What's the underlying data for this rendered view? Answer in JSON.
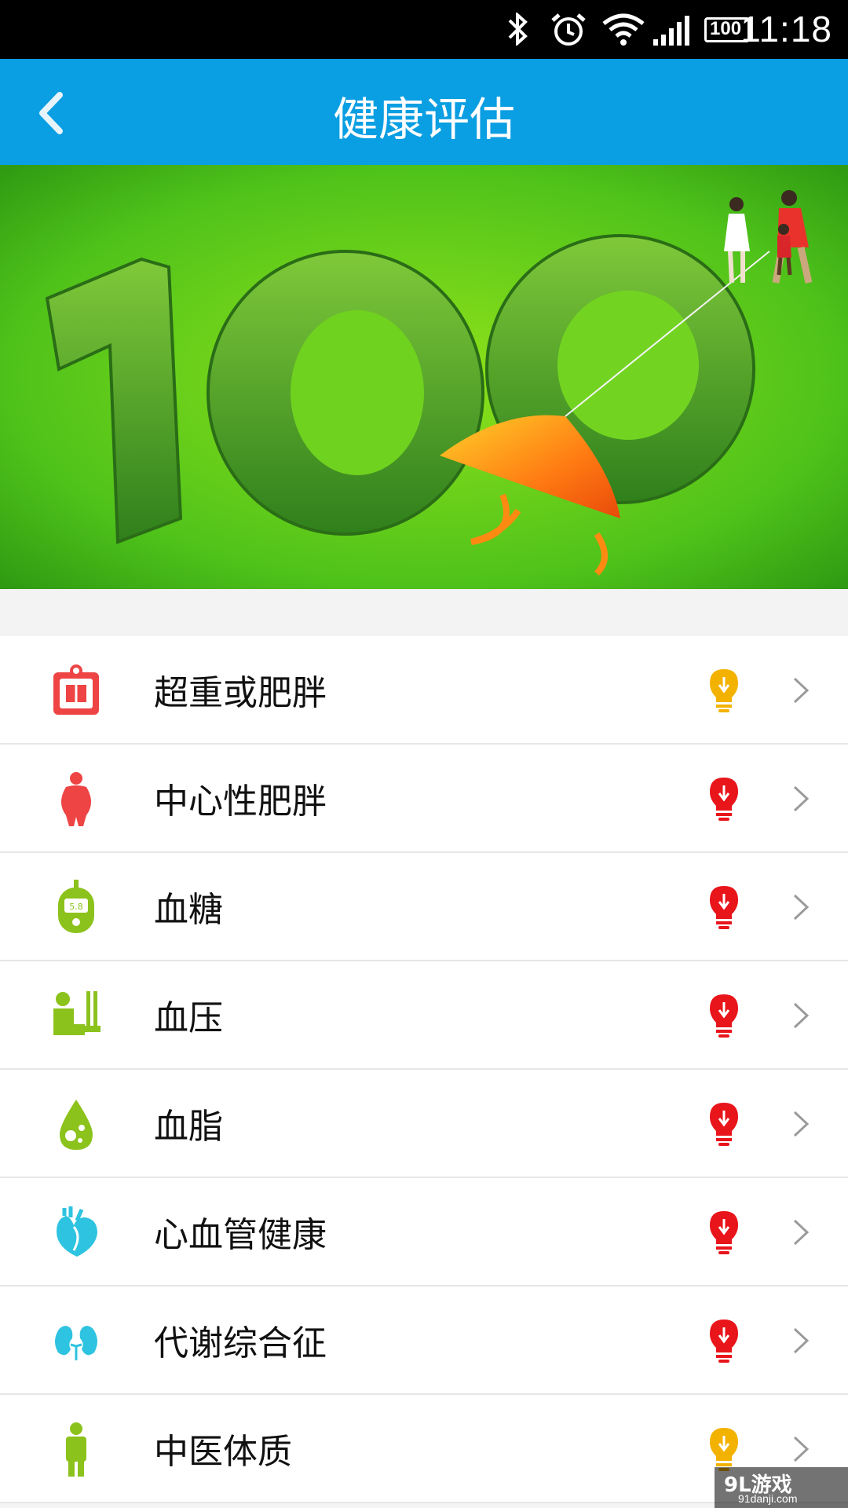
{
  "status_bar": {
    "time": "11:18",
    "battery": "100",
    "icons": [
      "bluetooth-icon",
      "alarm-icon",
      "wifi-icon",
      "signal-icon",
      "battery-icon"
    ]
  },
  "app_bar": {
    "title": "健康评估",
    "back_icon": "back-arrow-icon",
    "color": "#0a9ee2"
  },
  "banner": {
    "text": "100",
    "description_icon": "banner-image"
  },
  "assessments": [
    {
      "label": "超重或肥胖",
      "icon": "scale-icon",
      "icon_color": "#ee4444",
      "status": "yellow"
    },
    {
      "label": "中心性肥胖",
      "icon": "body-icon",
      "icon_color": "#ee4444",
      "status": "red"
    },
    {
      "label": "血糖",
      "icon": "glucose-meter-icon",
      "icon_color": "#8cc21c",
      "status": "red"
    },
    {
      "label": "血压",
      "icon": "blood-pressure-icon",
      "icon_color": "#8cc21c",
      "status": "red"
    },
    {
      "label": "血脂",
      "icon": "lipid-drop-icon",
      "icon_color": "#8cc21c",
      "status": "red"
    },
    {
      "label": "心血管健康",
      "icon": "heart-icon",
      "icon_color": "#2ec3e0",
      "status": "red"
    },
    {
      "label": "代谢综合征",
      "icon": "kidney-icon",
      "icon_color": "#2ec3e0",
      "status": "red"
    },
    {
      "label": "中医体质",
      "icon": "person-icon",
      "icon_color": "#8cc21c",
      "status": "yellow"
    }
  ],
  "status_colors": {
    "red": "#e8151b",
    "yellow": "#f3b200"
  },
  "watermark": {
    "title": "9L游戏",
    "subtitle": "91danji.com"
  }
}
